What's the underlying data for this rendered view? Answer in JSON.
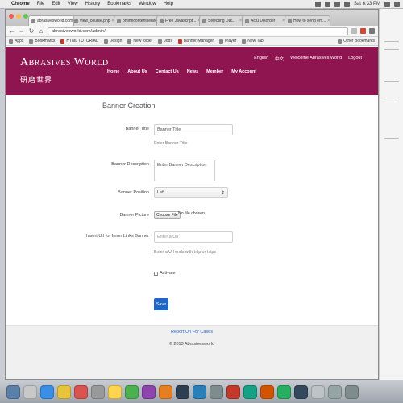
{
  "menubar": {
    "app": "Chrome",
    "items": [
      "File",
      "Edit",
      "View",
      "History",
      "Bookmarks",
      "Window",
      "Help"
    ],
    "clock": "Sat 6:33 PM"
  },
  "browser": {
    "tabs": [
      {
        "label": "abrasivesworld.com",
        "active": true
      },
      {
        "label": "view_course.php",
        "active": false
      },
      {
        "label": "onlinecontentservice.com",
        "active": false
      },
      {
        "label": "Free Javascript...",
        "active": false
      },
      {
        "label": "Selecting Dat...",
        "active": false
      },
      {
        "label": "Actu Disorder",
        "active": false
      },
      {
        "label": "How to send em...",
        "active": false
      }
    ],
    "url": "abrasivesworld.com/admin/",
    "bookmarks": [
      "Apps",
      "Bookmarks",
      "HTML TUTORIAL",
      "Design",
      "New folder",
      "Jobs",
      "Banner Manager",
      "Player",
      "New Tab"
    ],
    "other_bookmarks": "Other Bookmarks"
  },
  "site": {
    "logo_en": "Abrasives World",
    "logo_cn": "研磨世界",
    "nav": [
      "Home",
      "About Us",
      "Contact Us",
      "News",
      "Member",
      "My Account"
    ],
    "util_nav": [
      "English",
      "中文",
      "Welcome Abrasives World",
      "Logout"
    ]
  },
  "form": {
    "title": "Banner Creation",
    "banner_title": {
      "label": "Banner Title",
      "value": "Banner Title",
      "help": "Enter Banner Title"
    },
    "banner_description": {
      "label": "Banner Description",
      "placeholder": "Enter Banner Description"
    },
    "banner_position": {
      "label": "Banner Position",
      "value": "Left"
    },
    "banner_picture": {
      "label": "Banner Picture",
      "button": "Choose File",
      "status": "No file chosen"
    },
    "inner_links": {
      "label": "Insert Url for Inner Links Banner",
      "placeholder": "Enter a Url",
      "help": "Enter a Url ends with http or https"
    },
    "activate": {
      "label": "Activate"
    },
    "save": "Save"
  },
  "footer": {
    "report": "Report Url For Cases",
    "copyright": "© 2013 Abrasivesworld"
  },
  "colors": {
    "header_bg": "#8e1550",
    "primary_button": "#1f66c7",
    "footer_bg": "#f0f0f0"
  }
}
